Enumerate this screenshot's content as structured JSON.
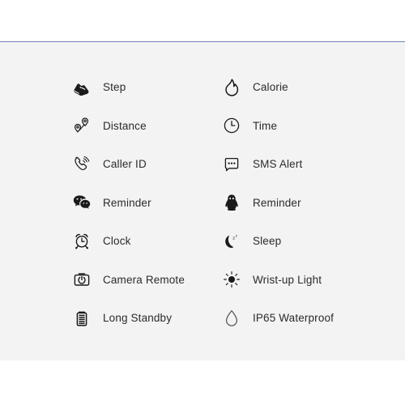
{
  "page": {
    "background_color": "#ffffff",
    "panel_color": "#f3f3f3",
    "divider_color": "#7082b8",
    "icon_color": "#1a1a1a",
    "text_color": "#2b2b2b"
  },
  "features": [
    {
      "icon": "sneaker-icon",
      "label": "Step"
    },
    {
      "icon": "flame-icon",
      "label": "Calorie"
    },
    {
      "icon": "route-pins-icon",
      "label": "Distance"
    },
    {
      "icon": "clock-circle-icon",
      "label": "Time"
    },
    {
      "icon": "phone-ring-icon",
      "label": "Caller ID"
    },
    {
      "icon": "speech-bubble-dots-icon",
      "label": "SMS Alert"
    },
    {
      "icon": "wechat-icon",
      "label": "Reminder"
    },
    {
      "icon": "qq-penguin-icon",
      "label": "Reminder"
    },
    {
      "icon": "alarm-clock-icon",
      "label": "Clock"
    },
    {
      "icon": "crescent-moon-zz-icon",
      "label": "Sleep"
    },
    {
      "icon": "camera-icon",
      "label": "Camera Remote"
    },
    {
      "icon": "sun-icon",
      "label": "Wrist-up Light"
    },
    {
      "icon": "battery-icon",
      "label": "Long Standby"
    },
    {
      "icon": "water-droplet-icon",
      "label": "IP65 Waterproof"
    }
  ]
}
